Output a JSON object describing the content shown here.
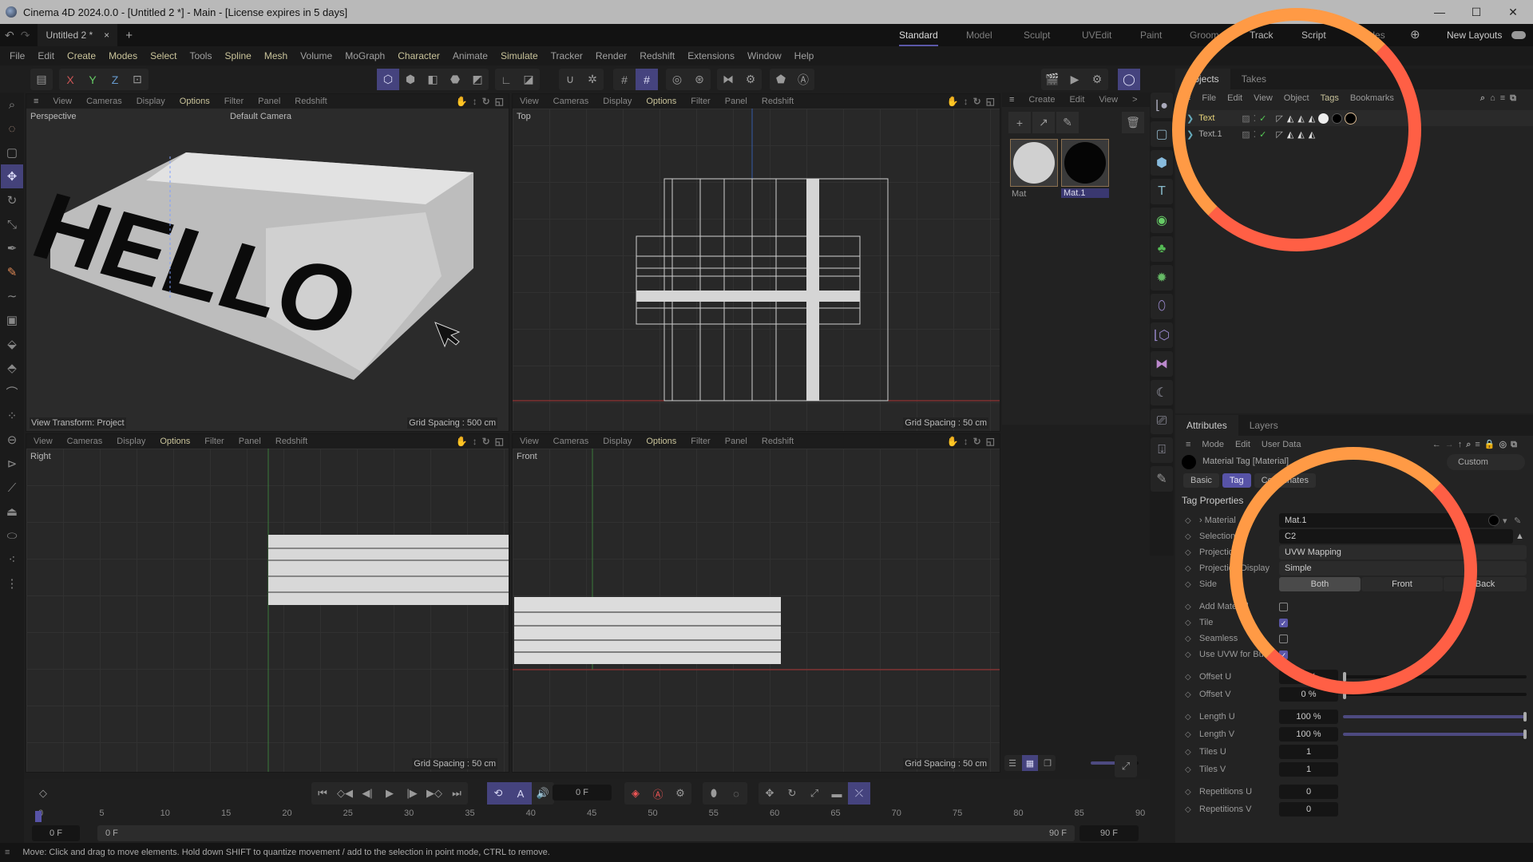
{
  "window": {
    "title": "Cinema 4D 2024.0.0 - [Untitled 2 *] - Main - [License expires in 5 days]",
    "controls": {
      "minimize": "—",
      "maximize": "☐",
      "close": "✕"
    }
  },
  "doc_tabs": [
    {
      "label": "Untitled 2 *",
      "close": "×"
    }
  ],
  "add_tab": "+",
  "layouts": [
    "Standard",
    "Model",
    "Sculpt",
    "UVEdit",
    "Paint",
    "Groom",
    "Track",
    "Script",
    "Nodes"
  ],
  "active_layout": "Standard",
  "new_layouts_label": "New Layouts",
  "menu": [
    "File",
    "Edit",
    "Create",
    "Modes",
    "Select",
    "Tools",
    "Spline",
    "Mesh",
    "Volume",
    "MoGraph",
    "Character",
    "Animate",
    "Simulate",
    "Tracker",
    "Render",
    "Redshift",
    "Extensions",
    "Window",
    "Help"
  ],
  "toolbar": {
    "axis": [
      "X",
      "Y",
      "Z"
    ],
    "modes": [
      "model-mode",
      "object-mode",
      "points-mode",
      "edges-mode",
      "polygons-mode",
      "uv-mode"
    ]
  },
  "viewports": [
    {
      "name": "Perspective",
      "camera": "Default Camera",
      "footer_left": "View Transform: Project",
      "grid": "Grid Spacing : 500 cm"
    },
    {
      "name": "Top",
      "grid": "Grid Spacing : 50 cm"
    },
    {
      "name": "Right",
      "grid": "Grid Spacing : 50 cm"
    },
    {
      "name": "Front",
      "grid": "Grid Spacing : 50 cm"
    }
  ],
  "viewport_menu": [
    "View",
    "Cameras",
    "Display",
    "Options",
    "Filter",
    "Panel",
    "Redshift"
  ],
  "viewport_text": "HELLO",
  "material_manager": {
    "menu": [
      "Create",
      "Edit",
      "View",
      ">"
    ],
    "materials": [
      {
        "name": "Mat",
        "color": "#d0d0d0"
      },
      {
        "name": "Mat.1",
        "color": "#050505",
        "selected": true
      }
    ]
  },
  "objects_panel": {
    "tabs": [
      "Objects",
      "Takes"
    ],
    "menu": [
      "File",
      "Edit",
      "View",
      "Object",
      "Tags",
      "Bookmarks"
    ],
    "objects": [
      {
        "name": "Text",
        "selected": true,
        "check": "✓",
        "tags": [
          "phong",
          "uvw",
          "uvw",
          "uvw",
          "mat-white",
          "mat-black",
          "mat-black-selected"
        ]
      },
      {
        "name": "Text.1",
        "selected": false,
        "check": "✓",
        "tags": [
          "phong",
          "uvw",
          "uvw",
          "uvw"
        ]
      }
    ]
  },
  "attributes_panel": {
    "tabs": [
      "Attributes",
      "Layers"
    ],
    "menu": [
      "Mode",
      "Edit",
      "User Data"
    ],
    "object_title": "Material Tag [Material]",
    "preset": "Custom",
    "sub_tabs": [
      "Basic",
      "Tag",
      "Coordinates"
    ],
    "active_sub_tab": "Tag",
    "section": "Tag Properties",
    "material": {
      "label": "Material",
      "value": "Mat.1"
    },
    "selection": {
      "label": "Selection",
      "value": "C2"
    },
    "projection": {
      "label": "Projection",
      "value": "UVW Mapping"
    },
    "projection_display": {
      "label": "Projection Display",
      "value": "Simple"
    },
    "side": {
      "label": "Side",
      "options": [
        "Both",
        "Front",
        "Back"
      ],
      "selected": "Both"
    },
    "checkboxes": [
      {
        "label": "Add Material",
        "checked": false
      },
      {
        "label": "Tile",
        "checked": true
      },
      {
        "label": "Seamless",
        "checked": false
      },
      {
        "label": "Use UVW for Bump",
        "checked": true
      }
    ],
    "offset_u": {
      "label": "Offset U",
      "value": "0 %",
      "fraction": 0
    },
    "offset_v": {
      "label": "Offset V",
      "value": "0 %",
      "fraction": 0
    },
    "length_u": {
      "label": "Length U",
      "value": "100 %",
      "fraction": 1
    },
    "length_v": {
      "label": "Length V",
      "value": "100 %",
      "fraction": 1
    },
    "tiles_u": {
      "label": "Tiles U",
      "value": "1"
    },
    "tiles_v": {
      "label": "Tiles V",
      "value": "1"
    },
    "repetitions_u": {
      "label": "Repetitions U",
      "value": "0"
    },
    "repetitions_v": {
      "label": "Repetitions V",
      "value": "0"
    }
  },
  "timeline": {
    "current_frame": "0 F",
    "start_field": "0 F",
    "range_start": "0 F",
    "range_end": "90 F",
    "end_field": "90 F",
    "ticks": [
      "0",
      "5",
      "10",
      "15",
      "20",
      "25",
      "30",
      "35",
      "40",
      "45",
      "50",
      "55",
      "60",
      "65",
      "70",
      "75",
      "80",
      "85",
      "90"
    ]
  },
  "status": "Move: Click and drag to move elements. Hold down SHIFT to quantize movement / add to the selection in point mode, CTRL to remove.",
  "colors": {
    "accent": "#45437e",
    "highlight_ring": "#ff7a45",
    "menu_highlight": "#c9c39a",
    "selected_object": "#e6d27a"
  }
}
